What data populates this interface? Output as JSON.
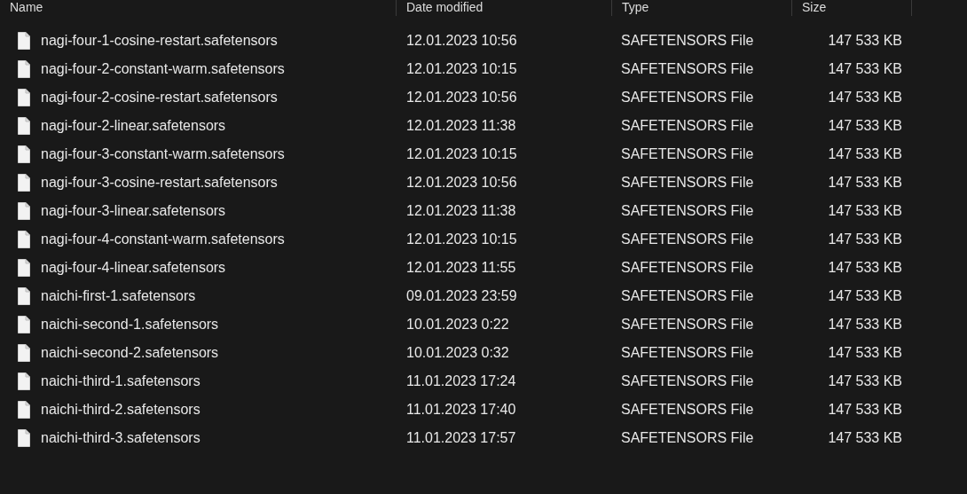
{
  "columns": [
    "Name",
    "Date modified",
    "Type",
    "Size"
  ],
  "files": [
    {
      "name": "nagi-four-1-cosine-restart.safetensors",
      "date": "12.01.2023 10:56",
      "type": "SAFETENSORS File",
      "size": "147 533 KB"
    },
    {
      "name": "nagi-four-2-constant-warm.safetensors",
      "date": "12.01.2023 10:15",
      "type": "SAFETENSORS File",
      "size": "147 533 KB"
    },
    {
      "name": "nagi-four-2-cosine-restart.safetensors",
      "date": "12.01.2023 10:56",
      "type": "SAFETENSORS File",
      "size": "147 533 KB"
    },
    {
      "name": "nagi-four-2-linear.safetensors",
      "date": "12.01.2023 11:38",
      "type": "SAFETENSORS File",
      "size": "147 533 KB"
    },
    {
      "name": "nagi-four-3-constant-warm.safetensors",
      "date": "12.01.2023 10:15",
      "type": "SAFETENSORS File",
      "size": "147 533 KB"
    },
    {
      "name": "nagi-four-3-cosine-restart.safetensors",
      "date": "12.01.2023 10:56",
      "type": "SAFETENSORS File",
      "size": "147 533 KB"
    },
    {
      "name": "nagi-four-3-linear.safetensors",
      "date": "12.01.2023 11:38",
      "type": "SAFETENSORS File",
      "size": "147 533 KB"
    },
    {
      "name": "nagi-four-4-constant-warm.safetensors",
      "date": "12.01.2023 10:15",
      "type": "SAFETENSORS File",
      "size": "147 533 KB"
    },
    {
      "name": "nagi-four-4-linear.safetensors",
      "date": "12.01.2023 11:55",
      "type": "SAFETENSORS File",
      "size": "147 533 KB"
    },
    {
      "name": "naichi-first-1.safetensors",
      "date": "09.01.2023 23:59",
      "type": "SAFETENSORS File",
      "size": "147 533 KB"
    },
    {
      "name": "naichi-second-1.safetensors",
      "date": "10.01.2023 0:22",
      "type": "SAFETENSORS File",
      "size": "147 533 KB"
    },
    {
      "name": "naichi-second-2.safetensors",
      "date": "10.01.2023 0:32",
      "type": "SAFETENSORS File",
      "size": "147 533 KB"
    },
    {
      "name": "naichi-third-1.safetensors",
      "date": "11.01.2023 17:24",
      "type": "SAFETENSORS File",
      "size": "147 533 KB"
    },
    {
      "name": "naichi-third-2.safetensors",
      "date": "11.01.2023 17:40",
      "type": "SAFETENSORS File",
      "size": "147 533 KB"
    },
    {
      "name": "naichi-third-3.safetensors",
      "date": "11.01.2023 17:57",
      "type": "SAFETENSORS File",
      "size": "147 533 KB"
    }
  ]
}
